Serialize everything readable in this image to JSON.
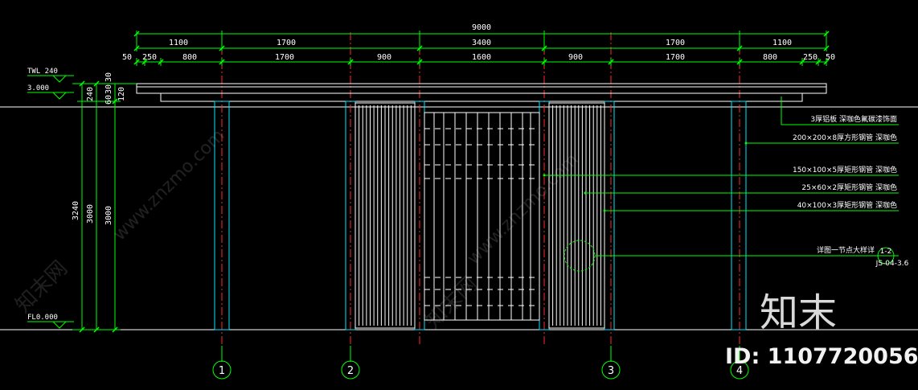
{
  "dimensions": {
    "total": "9000",
    "row1": [
      "1100",
      "1700",
      "3400",
      "1700",
      "1100"
    ],
    "row2": [
      "50",
      "250",
      "800",
      "1700",
      "900",
      "1600",
      "900",
      "1700",
      "800",
      "250",
      "50"
    ],
    "left_vertical": [
      "3240",
      "3000",
      "3000"
    ],
    "left_top": [
      "30",
      "240",
      "30",
      "60",
      "120"
    ]
  },
  "levels": [
    "TWL 240",
    "3.000",
    "FL0.000"
  ],
  "notes": [
    "3厚铝板 深咖色氟碳漆饰面",
    "200×200×8厚方形钢管 深咖色",
    "150×100×5厚矩形钢管 深咖色",
    "25×60×2厚矩形钢管 深咖色",
    "40×100×3厚矩形钢管 深咖色",
    "详图一节点大样详"
  ],
  "detail_ref": {
    "number": "1-2",
    "sheet": "JS-04-3.6"
  },
  "axes": [
    "1",
    "2",
    "3",
    "4"
  ],
  "watermark": {
    "brand": "知末",
    "id": "ID: 1107720056",
    "site": "www.znzmo.com",
    "net": "知末网"
  }
}
